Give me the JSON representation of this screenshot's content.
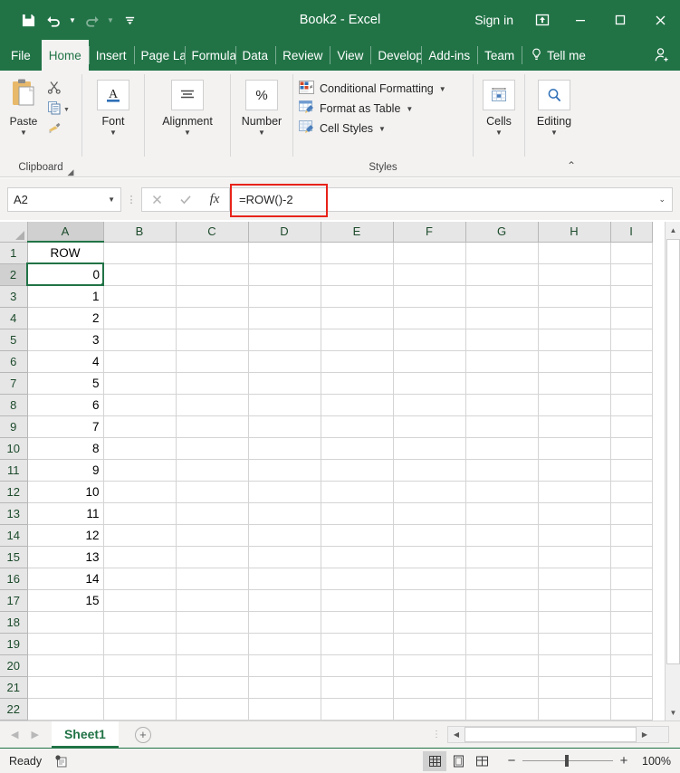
{
  "window": {
    "title": "Book2 - Excel",
    "signin": "Sign in",
    "quick_access": [
      {
        "name": "save",
        "label": "Save"
      },
      {
        "name": "undo",
        "label": "Undo"
      },
      {
        "name": "redo",
        "label": "Redo"
      },
      {
        "name": "customize",
        "label": "Customize Quick Access Toolbar"
      }
    ],
    "controls": [
      {
        "name": "ribbon-display-options",
        "label": "Ribbon Display Options"
      },
      {
        "name": "minimize",
        "label": "Minimize"
      },
      {
        "name": "maximize",
        "label": "Maximize"
      },
      {
        "name": "close",
        "label": "Close"
      }
    ]
  },
  "tabs": {
    "items": [
      {
        "label": "File",
        "active": false
      },
      {
        "label": "Home",
        "active": true
      },
      {
        "label": "Insert",
        "active": false
      },
      {
        "label": "Page La",
        "active": false
      },
      {
        "label": "Formula",
        "active": false
      },
      {
        "label": "Data",
        "active": false
      },
      {
        "label": "Review",
        "active": false
      },
      {
        "label": "View",
        "active": false
      },
      {
        "label": "Develop",
        "active": false
      },
      {
        "label": "Add-ins",
        "active": false
      },
      {
        "label": "Team",
        "active": false
      }
    ],
    "tellme": "Tell me"
  },
  "ribbon": {
    "clipboard": {
      "group_label": "Clipboard",
      "paste_label": "Paste",
      "cut_label": "Cut",
      "copy_label": "Copy",
      "format_painter_label": "Format Painter"
    },
    "font": {
      "label": "Font"
    },
    "alignment": {
      "label": "Alignment"
    },
    "number": {
      "label": "Number"
    },
    "styles": {
      "group_label": "Styles",
      "items": [
        {
          "label": "Conditional Formatting",
          "icon": "conditional-formatting-icon"
        },
        {
          "label": "Format as Table",
          "icon": "format-as-table-icon"
        },
        {
          "label": "Cell Styles",
          "icon": "cell-styles-icon"
        }
      ]
    },
    "cells": {
      "label": "Cells"
    },
    "editing": {
      "label": "Editing"
    }
  },
  "formula_bar": {
    "name_box": "A2",
    "formula": "=ROW()-2",
    "cancel_label": "Cancel",
    "enter_label": "Enter",
    "insert_function_label": "fx",
    "highlight_color": "#e8231a"
  },
  "sheet": {
    "columns": [
      "A",
      "B",
      "C",
      "D",
      "E",
      "F",
      "G",
      "H",
      "I"
    ],
    "selected_column": "A",
    "selected_cell": "A2",
    "rows": [
      {
        "num": "1",
        "a": "ROW",
        "align": "ctr"
      },
      {
        "num": "2",
        "a": "0",
        "align": "num"
      },
      {
        "num": "3",
        "a": "1",
        "align": "num"
      },
      {
        "num": "4",
        "a": "2",
        "align": "num"
      },
      {
        "num": "5",
        "a": "3",
        "align": "num"
      },
      {
        "num": "6",
        "a": "4",
        "align": "num"
      },
      {
        "num": "7",
        "a": "5",
        "align": "num"
      },
      {
        "num": "8",
        "a": "6",
        "align": "num"
      },
      {
        "num": "9",
        "a": "7",
        "align": "num"
      },
      {
        "num": "10",
        "a": "8",
        "align": "num"
      },
      {
        "num": "11",
        "a": "9",
        "align": "num"
      },
      {
        "num": "12",
        "a": "10",
        "align": "num"
      },
      {
        "num": "13",
        "a": "11",
        "align": "num"
      },
      {
        "num": "14",
        "a": "12",
        "align": "num"
      },
      {
        "num": "15",
        "a": "13",
        "align": "num"
      },
      {
        "num": "16",
        "a": "14",
        "align": "num"
      },
      {
        "num": "17",
        "a": "15",
        "align": "num"
      },
      {
        "num": "18",
        "a": "",
        "align": "num"
      },
      {
        "num": "19",
        "a": "",
        "align": "num"
      },
      {
        "num": "20",
        "a": "",
        "align": "num"
      },
      {
        "num": "21",
        "a": "",
        "align": "num"
      },
      {
        "num": "22",
        "a": "",
        "align": "num"
      }
    ]
  },
  "sheet_tabs": {
    "active": "Sheet1",
    "add_label": "New sheet"
  },
  "status": {
    "text": "Ready",
    "zoom": "100%",
    "views": [
      {
        "name": "normal-view",
        "active": true
      },
      {
        "name": "page-layout-view",
        "active": false
      },
      {
        "name": "page-break-preview",
        "active": false
      }
    ],
    "zoom_out_label": "−",
    "zoom_in_label": "+"
  },
  "theme": {
    "excel_green": "#217346",
    "ribbon_bg": "#f3f2f1",
    "header_bg": "#e6e6e6"
  }
}
